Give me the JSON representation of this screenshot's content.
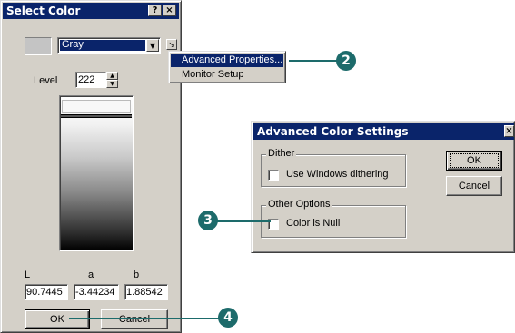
{
  "select_color": {
    "title": "Select Color",
    "help_btn": "?",
    "close_btn": "×",
    "color_model": "Gray",
    "level_label": "Level",
    "level_value": "222",
    "lab_labels": [
      "L",
      "a",
      "b"
    ],
    "lab_values": [
      "90.7445",
      "-3.44234",
      "1.88542"
    ],
    "ok_label": "OK",
    "cancel_label": "Cancel"
  },
  "popup_menu": {
    "items": [
      "Advanced Properties...",
      "Monitor Setup"
    ]
  },
  "advanced": {
    "title": "Advanced Color Settings",
    "close_btn": "×",
    "dither_group": "Dither",
    "use_windows_dithering": "Use Windows dithering",
    "other_group": "Other Options",
    "color_is_null": "Color is Null",
    "ok_label": "OK",
    "cancel_label": "Cancel"
  },
  "callouts": [
    "2",
    "3",
    "4"
  ],
  "colors": {
    "titlebar": "#0a246a",
    "face": "#d4d0c8",
    "callout": "#1d6b6b"
  },
  "icons": {
    "menu_arrow": "menu-arrow-icon",
    "dropdown": "chevron-down-icon",
    "spin": "spin-arrows-icon"
  }
}
